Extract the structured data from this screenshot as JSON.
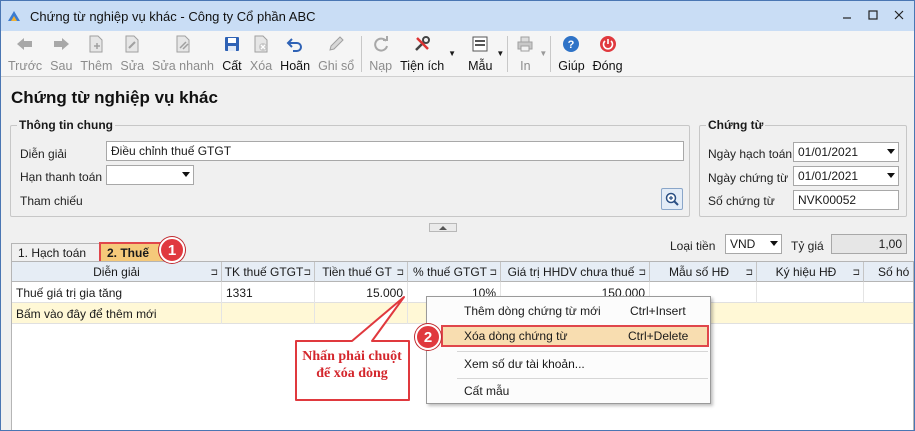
{
  "window": {
    "title": "Chứng từ nghiệp vụ khác - Công ty Cổ phần ABC"
  },
  "toolbar": {
    "items": [
      {
        "label": "Trước",
        "icon": "arrow-left-icon",
        "enabled": false
      },
      {
        "label": "Sau",
        "icon": "arrow-right-icon",
        "enabled": false
      },
      {
        "label": "Thêm",
        "icon": "add-document-icon",
        "enabled": false
      },
      {
        "label": "Sửa",
        "icon": "edit-document-icon",
        "enabled": false
      },
      {
        "label": "Sửa nhanh",
        "icon": "quick-edit-icon",
        "enabled": false
      },
      {
        "label": "Cất",
        "icon": "save-icon",
        "enabled": true
      },
      {
        "label": "Xóa",
        "icon": "delete-icon",
        "enabled": false
      },
      {
        "label": "Hoãn",
        "icon": "undo-icon",
        "enabled": true
      },
      {
        "label": "Ghi sổ",
        "icon": "pencil-icon",
        "enabled": false
      },
      {
        "label": "Nạp",
        "icon": "refresh-icon",
        "enabled": false
      },
      {
        "label": "Tiện ích",
        "icon": "tools-icon",
        "enabled": true
      },
      {
        "label": "Mẫu",
        "icon": "template-icon",
        "enabled": true
      },
      {
        "label": "In",
        "icon": "printer-icon",
        "enabled": false
      },
      {
        "label": "Giúp",
        "icon": "help-icon",
        "enabled": true
      },
      {
        "label": "Đóng",
        "icon": "power-icon",
        "enabled": true
      }
    ]
  },
  "page": {
    "heading": "Chứng từ nghiệp vụ khác"
  },
  "general_info": {
    "title": "Thông tin chung",
    "description_label": "Diễn giải",
    "description_value": "Điều chỉnh thuế GTGT",
    "due_label": "Hạn thanh toán",
    "due_value": "",
    "reference_label": "Tham chiếu"
  },
  "voucher": {
    "title": "Chứng từ",
    "posting_date_label": "Ngày hạch toán",
    "posting_date_value": "01/01/2021",
    "voucher_date_label": "Ngày chứng từ",
    "voucher_date_value": "01/01/2021",
    "voucher_no_label": "Số chứng từ",
    "voucher_no_value": "NVK00052"
  },
  "tabs": [
    {
      "label": "1. Hạch toán",
      "active": false
    },
    {
      "label": "2. Thuế",
      "active": true
    }
  ],
  "currency": {
    "label": "Loại tiền",
    "value": "VND",
    "rate_label": "Tỷ giá",
    "rate_value": "1,00"
  },
  "grid": {
    "columns": [
      "Diễn giải",
      "TK thuế GTGT",
      "Tiền thuế GT",
      "% thuế GTGT",
      "Giá trị HHDV chưa thuế",
      "Mẫu số HĐ",
      "Ký hiệu HĐ",
      "Số hó"
    ],
    "rows": [
      {
        "description": "Thuế giá trị gia tăng",
        "tax_account": "1331",
        "tax_amount": "15.000",
        "tax_rate": "10%",
        "goods_value": "150.000"
      }
    ],
    "new_row_hint": "Bấm vào đây để thêm mới"
  },
  "context_menu": {
    "items": [
      {
        "label": "Thêm dòng chứng từ mới",
        "shortcut": "Ctrl+Insert"
      },
      {
        "label": "Xóa dòng chứng từ",
        "shortcut": "Ctrl+Delete",
        "highlighted": true
      },
      {
        "label": "Xem số dư tài khoản...",
        "shortcut": ""
      },
      {
        "label": "Cất mẫu",
        "shortcut": ""
      }
    ]
  },
  "annotations": {
    "badge1": "1",
    "badge2": "2",
    "callout_line1": "Nhấn phải chuột",
    "callout_line2": "để xóa dòng",
    "accent_color": "#e0393e"
  }
}
